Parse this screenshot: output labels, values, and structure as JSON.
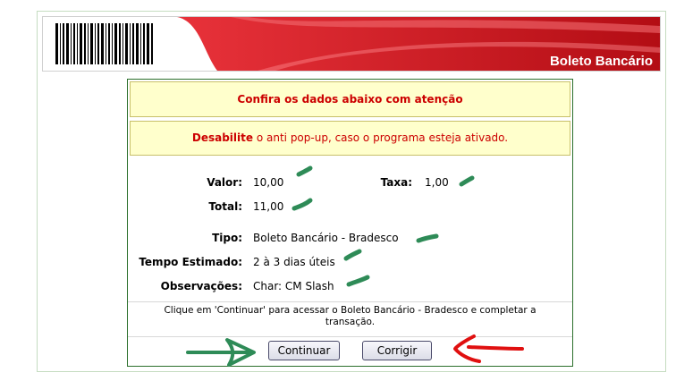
{
  "header": {
    "title": "Boleto Bancário"
  },
  "notices": {
    "confirm": "Confira os dados abaixo com atenção",
    "popup_bold": "Desabilite",
    "popup_rest": " o anti pop-up, caso o programa esteja ativado."
  },
  "details": {
    "valor_label": "Valor:",
    "valor_value": "10,00",
    "taxa_label": "Taxa:",
    "taxa_value": "1,00",
    "total_label": "Total:",
    "total_value": "11,00",
    "tipo_label": "Tipo:",
    "tipo_value": "Boleto Bancário - Bradesco",
    "tempo_label": "Tempo Estimado:",
    "tempo_value": "2 à 3 dias úteis",
    "obs_label": "Observações:",
    "obs_value": "Char: CM Slash"
  },
  "info": {
    "line1": "Clique em 'Continuar' para acessar o Boleto Bancário - Bradesco e completar a",
    "line2": "transação."
  },
  "buttons": {
    "continuar": "Continuar",
    "corrigir": "Corrigir"
  },
  "colors": {
    "header_red": "#d0121b",
    "notice_text": "#cc0000",
    "notice_bg": "#ffffcc",
    "panel_border": "#2b6f2b",
    "annotation_green": "#2e8b57",
    "annotation_red": "#e01010"
  },
  "icons": {
    "barcode": "barcode-icon"
  }
}
